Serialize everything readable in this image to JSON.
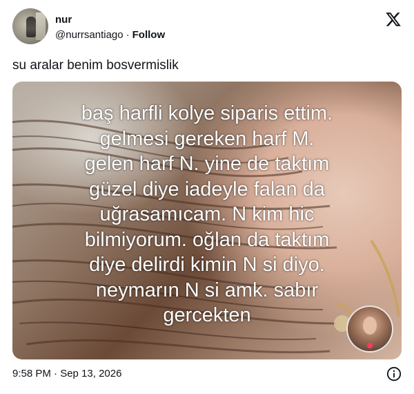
{
  "author": {
    "name": "nur",
    "handle": "@nurrsantiago",
    "separator": "·",
    "follow_label": "Follow"
  },
  "tweet": {
    "text": "su aralar benim bosvermislik"
  },
  "media": {
    "overlay_lines": [
      "baş harfli kolye siparis ettim.",
      "gelmesi gereken harf M.",
      "gelen harf N. yine de taktım",
      "güzel diye iadeyle falan da",
      "uğrasamıcam. N kim hic",
      "bilmiyorum. oğlan da taktım",
      "diye delirdi kimin N si diyo.",
      "neymarın N si amk. sabır",
      "gercekten"
    ]
  },
  "footer": {
    "timestamp": "9:58 PM · Sep 13, 2026"
  },
  "icons": {
    "platform_logo": "x-logo-icon",
    "info": "info-icon"
  },
  "colors": {
    "text": "#0f1419",
    "overlay_text": "#ffffff"
  }
}
